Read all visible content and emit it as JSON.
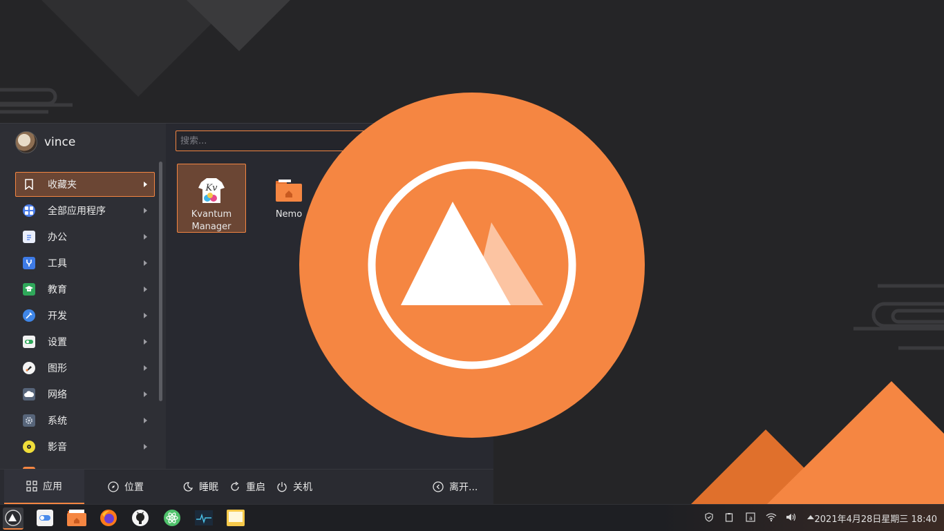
{
  "user": {
    "name": "vince"
  },
  "search": {
    "placeholder": "搜索...",
    "value": ""
  },
  "categories": [
    {
      "label": "收藏夹",
      "icon": "bookmark-icon"
    },
    {
      "label": "全部应用程序",
      "icon": "all-apps-icon"
    },
    {
      "label": "办公",
      "icon": "office-icon"
    },
    {
      "label": "工具",
      "icon": "tools-icon"
    },
    {
      "label": "教育",
      "icon": "education-icon"
    },
    {
      "label": "开发",
      "icon": "development-icon"
    },
    {
      "label": "设置",
      "icon": "settings-icon"
    },
    {
      "label": "图形",
      "icon": "graphics-icon"
    },
    {
      "label": "网络",
      "icon": "network-icon"
    },
    {
      "label": "系统",
      "icon": "system-icon"
    },
    {
      "label": "影音",
      "icon": "multimedia-icon"
    }
  ],
  "apps": [
    {
      "label": "Kvantum Manager",
      "icon": "kvantum-icon"
    },
    {
      "label": "Nemo",
      "icon": "folder-home-icon"
    }
  ],
  "bottom": {
    "apps": "应用",
    "places": "位置",
    "sleep": "睡眠",
    "restart": "重启",
    "shutdown": "关机",
    "leave": "离开..."
  },
  "taskbar": {
    "apps": [
      "start-menu-icon",
      "settings-toggle-icon",
      "file-manager-icon",
      "firefox-icon",
      "github-icon",
      "atom-icon",
      "system-monitor-icon",
      "notes-icon"
    ],
    "tray": [
      "shield-icon",
      "clipboard-icon",
      "keyboard-layout-icon",
      "wifi-icon",
      "volume-icon",
      "tray-expand-icon"
    ],
    "clock": "2021年4月28日星期三 18:40"
  },
  "colors": {
    "accent": "#f58642",
    "background": "#252527",
    "panel": "#2a2b31"
  }
}
